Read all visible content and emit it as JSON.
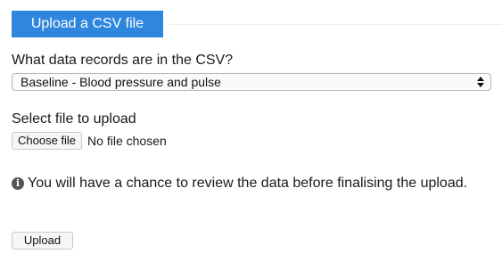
{
  "tab": {
    "label": "Upload a CSV file"
  },
  "record_type": {
    "question": "What data records are in the CSV?",
    "selected": "Baseline - Blood pressure and pulse"
  },
  "file": {
    "label": "Select file to upload",
    "choose_label": "Choose file",
    "status": "No file chosen"
  },
  "info": {
    "icon": "info-circle-icon",
    "text": "You will have a chance to review the data before finalising the upload."
  },
  "actions": {
    "upload_label": "Upload"
  },
  "colors": {
    "accent": "#2e86de",
    "text": "#1a1a1a",
    "border": "#b8b8b8"
  }
}
